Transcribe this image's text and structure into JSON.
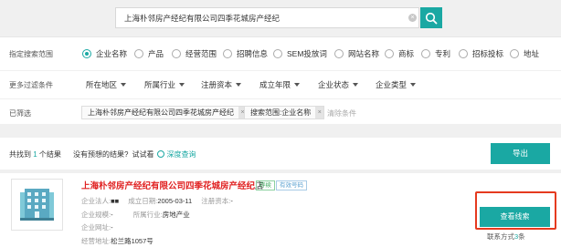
{
  "search": {
    "query": "上海朴邻房产经纪有限公司四季花城房产经纪"
  },
  "filters": {
    "scope_label": "指定搜索范围",
    "scope_options": [
      "企业名称",
      "产品",
      "经营范围",
      "招聘信息",
      "SEM投放词",
      "网站名称",
      "商标",
      "专利",
      "招标投标",
      "地址"
    ],
    "scope_selected": "企业名称",
    "more_label": "更多过滤条件",
    "more_options": [
      "所在地区",
      "所属行业",
      "注册资本",
      "成立年限",
      "企业状态",
      "企业类型"
    ],
    "selected_label": "已筛选",
    "selected_tags": [
      "上海朴邻房产经纪有限公司四季花城房产经纪",
      "搜索范围:企业名称"
    ],
    "clear_all": "清除条件"
  },
  "results": {
    "found_prefix": "共找到",
    "count": "1",
    "found_suffix": "个结果",
    "no_result_q": "没有预想的结果?",
    "try_text": "试试看",
    "deep_search": "深度查询",
    "export": "导出"
  },
  "company": {
    "name": "上海朴邻房产经纪有限公司四季花城房产经纪",
    "name_suffix": "店",
    "badge_status": "存续",
    "badge_phone": "有效号码",
    "legal_label": "企业法人:",
    "legal_value": "■■",
    "founded_label": "成立日期:",
    "founded_value": "2005-03-11",
    "capital_label": "注册资本:",
    "capital_value": "-",
    "scale_label": "企业规模:",
    "scale_value": "-",
    "industry_label": "所属行业:",
    "industry_value": "房地产业",
    "website_label": "企业网址:",
    "website_value": "-",
    "address_label": "经营地址:",
    "address_value": "松兰路1057号",
    "view_button": "查看线索",
    "contact_prefix": "联系方式",
    "contact_count": "3",
    "contact_suffix": "条"
  }
}
